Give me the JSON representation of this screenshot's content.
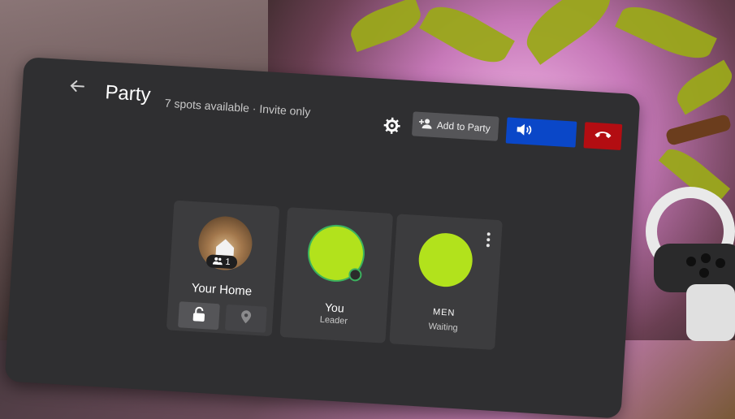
{
  "header": {
    "title": "Party",
    "subtitle": "7 spots available · Invite only"
  },
  "toolbar": {
    "add_label": "Add to Party"
  },
  "cards": {
    "home": {
      "name": "Your Home",
      "badge_count": "1"
    },
    "you": {
      "name": "You",
      "role": "Leader"
    },
    "other": {
      "name": "MEN",
      "role": "Waiting"
    }
  },
  "colors": {
    "accent_blue": "#0a47c8",
    "end_red": "#b30d12",
    "avatar_green": "#b2e21c"
  },
  "icons": [
    "back-arrow-icon",
    "gear-icon",
    "add-person-icon",
    "volume-icon",
    "end-call-icon",
    "lock-icon",
    "location-icon",
    "people-icon",
    "mic-icon",
    "kebab-icon"
  ]
}
